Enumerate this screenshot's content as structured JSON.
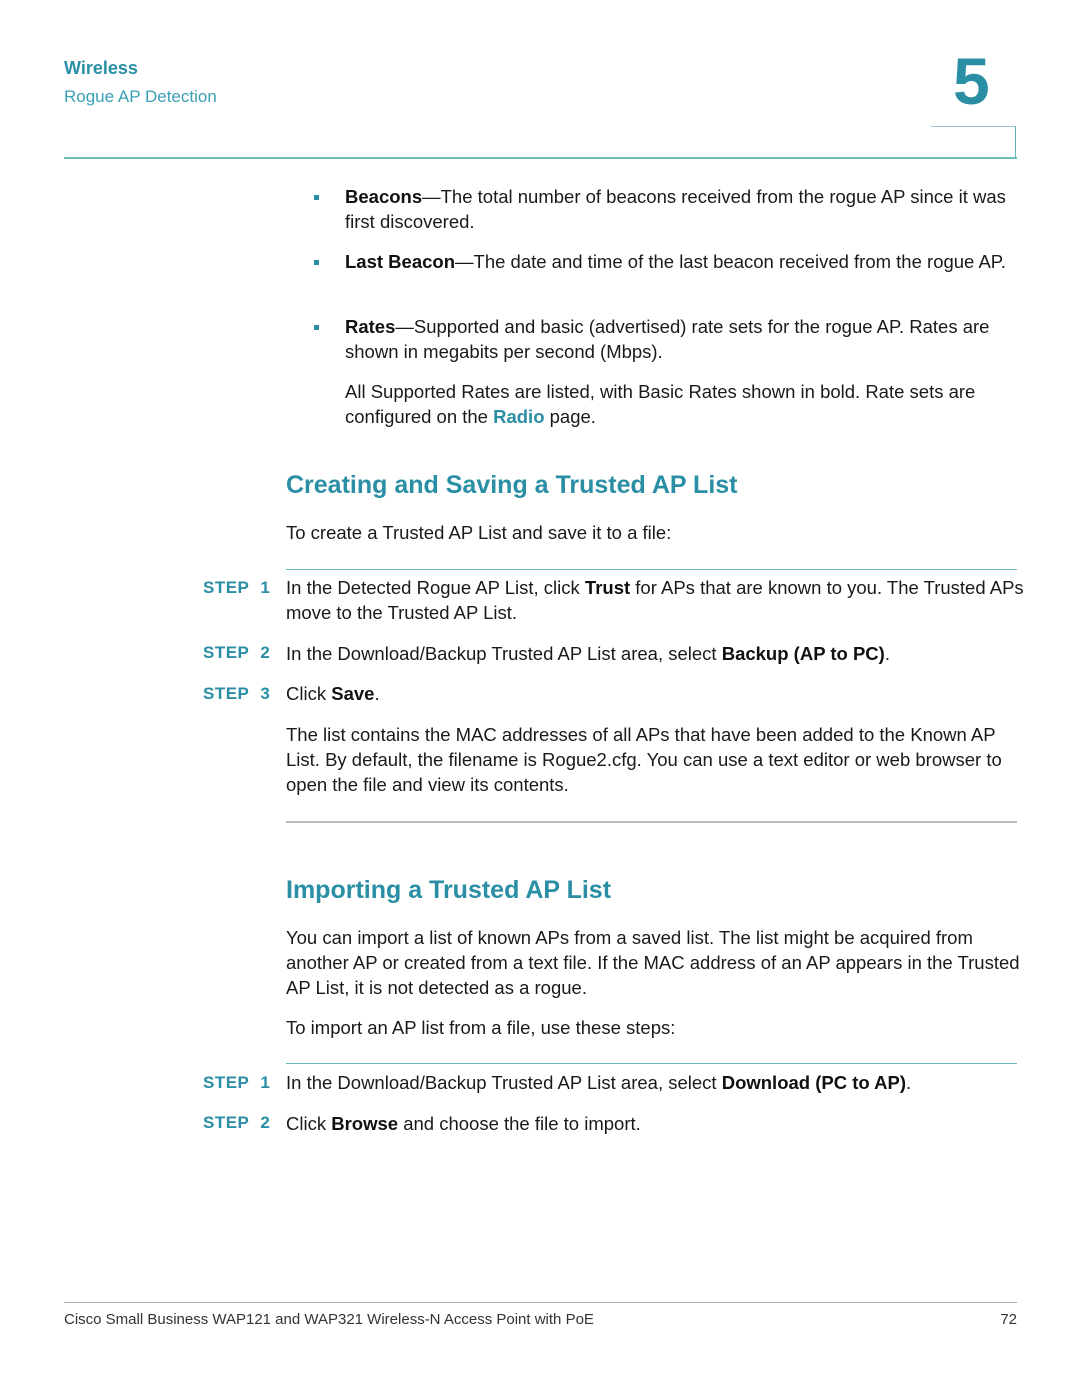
{
  "header": {
    "chapter_title": "Wireless",
    "section_title": "Rogue AP Detection",
    "chapter_number": "5"
  },
  "bullets": [
    {
      "term": "Beacons",
      "text": "—The total number of beacons received from the rogue AP since it was first discovered."
    },
    {
      "term": "Last Beacon",
      "text": "—The date and time of the last beacon received from the rogue AP."
    },
    {
      "term": "Rates",
      "text": "—Supported and basic (advertised) rate sets for the rogue AP. Rates are shown in megabits per second (Mbps)."
    }
  ],
  "rates_note": {
    "before": "All Supported Rates are listed, with Basic Rates shown in bold. Rate sets are configured on the ",
    "link": "Radio",
    "after": " page."
  },
  "section1": {
    "title": "Creating and Saving a Trusted AP List",
    "intro": "To create a Trusted AP List and save it to a file:",
    "steps": [
      {
        "label": "STEP 1",
        "parts": [
          "In the Detected Rogue AP List, click ",
          "Trust",
          " for APs that are known to you. The Trusted APs move to the Trusted AP List."
        ]
      },
      {
        "label": "STEP 2",
        "parts": [
          "In the Download/Backup Trusted AP List area, select ",
          "Backup (AP to PC)",
          "."
        ]
      },
      {
        "label": "STEP 3",
        "parts": [
          "Click ",
          "Save",
          "."
        ]
      }
    ],
    "note": "The list contains the MAC addresses of all APs that have been added to the Known AP List. By default, the filename is Rogue2.cfg. You can use a text editor or web browser to open the file and view its contents."
  },
  "section2": {
    "title": "Importing a Trusted AP List",
    "intro": "You can import a list of known APs from a saved list. The list might be acquired from another AP or created from a text file. If the MAC address of an AP appears in the Trusted AP List, it is not detected as a rogue.",
    "intro2": "To import an AP list from a file, use these steps:",
    "steps": [
      {
        "label": "STEP 1",
        "parts": [
          "In the Download/Backup Trusted AP List area, select ",
          "Download (PC to AP)",
          "."
        ]
      },
      {
        "label": "STEP 2",
        "parts": [
          "Click ",
          "Browse",
          " and choose the file to import."
        ]
      }
    ]
  },
  "footer": {
    "text": "Cisco Small Business WAP121 and WAP321 Wireless-N Access Point with PoE",
    "page": "72"
  }
}
